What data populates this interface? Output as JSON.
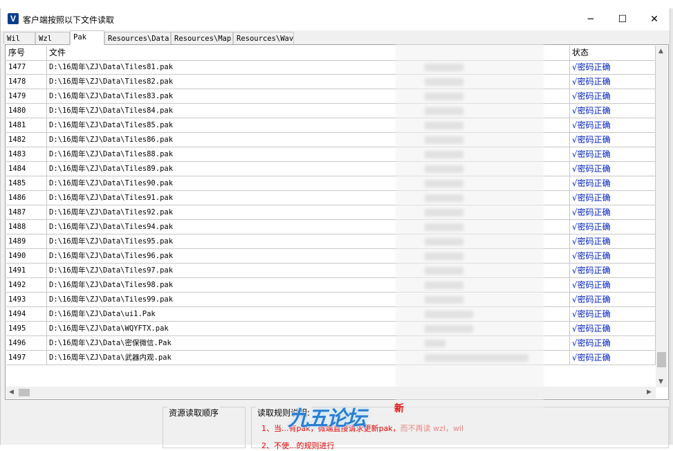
{
  "window": {
    "title": "客户端按照以下文件读取",
    "app_icon_letter": "V"
  },
  "controls": {
    "minimize": "─",
    "maximize": "☐",
    "close": "✕"
  },
  "tabs": [
    {
      "label": "Wil"
    },
    {
      "label": "Wzl"
    },
    {
      "label": "Pak"
    },
    {
      "label": "Resources\\Data"
    },
    {
      "label": "Resources\\Map"
    },
    {
      "label": "Resources\\Wav"
    }
  ],
  "table": {
    "headers": {
      "index": "序号",
      "file": "文件",
      "status": "状态"
    },
    "rows": [
      {
        "index": "1477",
        "file": "D:\\16周年\\ZJ\\Data\\Tiles81.pak",
        "status": "√密码正确"
      },
      {
        "index": "1478",
        "file": "D:\\16周年\\ZJ\\Data\\Tiles82.pak",
        "status": "√密码正确"
      },
      {
        "index": "1479",
        "file": "D:\\16周年\\ZJ\\Data\\Tiles83.pak",
        "status": "√密码正确"
      },
      {
        "index": "1480",
        "file": "D:\\16周年\\ZJ\\Data\\Tiles84.pak",
        "status": "√密码正确"
      },
      {
        "index": "1481",
        "file": "D:\\16周年\\ZJ\\Data\\Tiles85.pak",
        "status": "√密码正确"
      },
      {
        "index": "1482",
        "file": "D:\\16周年\\ZJ\\Data\\Tiles86.pak",
        "status": "√密码正确"
      },
      {
        "index": "1483",
        "file": "D:\\16周年\\ZJ\\Data\\Tiles88.pak",
        "status": "√密码正确"
      },
      {
        "index": "1484",
        "file": "D:\\16周年\\ZJ\\Data\\Tiles89.pak",
        "status": "√密码正确"
      },
      {
        "index": "1485",
        "file": "D:\\16周年\\ZJ\\Data\\Tiles90.pak",
        "status": "√密码正确"
      },
      {
        "index": "1486",
        "file": "D:\\16周年\\ZJ\\Data\\Tiles91.pak",
        "status": "√密码正确"
      },
      {
        "index": "1487",
        "file": "D:\\16周年\\ZJ\\Data\\Tiles92.pak",
        "status": "√密码正确"
      },
      {
        "index": "1488",
        "file": "D:\\16周年\\ZJ\\Data\\Tiles94.pak",
        "status": "√密码正确"
      },
      {
        "index": "1489",
        "file": "D:\\16周年\\ZJ\\Data\\Tiles95.pak",
        "status": "√密码正确"
      },
      {
        "index": "1490",
        "file": "D:\\16周年\\ZJ\\Data\\Tiles96.pak",
        "status": "√密码正确"
      },
      {
        "index": "1491",
        "file": "D:\\16周年\\ZJ\\Data\\Tiles97.pak",
        "status": "√密码正确"
      },
      {
        "index": "1492",
        "file": "D:\\16周年\\ZJ\\Data\\Tiles98.pak",
        "status": "√密码正确"
      },
      {
        "index": "1493",
        "file": "D:\\16周年\\ZJ\\Data\\Tiles99.pak",
        "status": "√密码正确"
      },
      {
        "index": "1494",
        "file": "D:\\16周年\\ZJ\\Data\\ui1.Pak",
        "status": "√密码正确"
      },
      {
        "index": "1495",
        "file": "D:\\16周年\\ZJ\\Data\\WQYFTX.pak",
        "status": "√密码正确"
      },
      {
        "index": "1496",
        "file": "D:\\16周年\\ZJ\\Data\\密保微信.Pak",
        "status": "√密码正确"
      },
      {
        "index": "1497",
        "file": "D:\\16周年\\ZJ\\Data\\武器内观.pak",
        "status": "√密码正确"
      }
    ]
  },
  "bottom": {
    "order_title": "资源读取顺序",
    "rules_title": "读取规则说明:",
    "rules": [
      "1、当...有pak，微端直接请求更新pak，而不再读 wzl，wil",
      "2、不使...的规则进行"
    ],
    "accent_color": "#e00000"
  },
  "watermark": {
    "text": "九五论坛",
    "badge": "新"
  }
}
